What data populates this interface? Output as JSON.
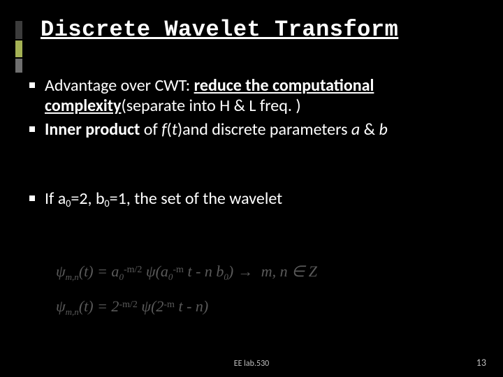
{
  "title": "Discrete Wavelet Transform",
  "bullets": {
    "b1": {
      "pre": "Advantage over CWT: ",
      "strong": "reduce the computational complexity",
      "post": "(separate into H & L freq. )"
    },
    "b2": {
      "strong": "Inner product",
      "mid": " of ",
      "fn": "f",
      "paren_t": "(",
      "t": "t",
      "paren_close": ")",
      "mid2": "and discrete parameters ",
      "a": "a",
      "amp": " & ",
      "b": "b"
    },
    "b3": {
      "pre": "If a",
      "sub0a": "0",
      "eq2": "=2, b",
      "sub0b": "0",
      "eq1": "=1, the set of the wavelet"
    }
  },
  "equations": {
    "line1": {
      "psi": "ψ",
      "sub": "m,n",
      "t": "(t)",
      "eq": " = a",
      "sub0": "0",
      "exp_pre": "",
      "exp": "-m/2",
      "psi2": " ψ",
      "arg_open": "(a",
      "sub0b": "0",
      "exp2": "-m",
      "rest": " t - n b",
      "sub0c": "0",
      "close": ")",
      "tail": "     m, n ∈ Z"
    },
    "line2": {
      "psi": "ψ",
      "sub": "m,n",
      "t": "(t)",
      "eq": " = 2",
      "exp": "-m/2",
      "psi2": " ψ",
      "arg": "(2",
      "exp2": "-m",
      "rest": " t - n)"
    }
  },
  "footer": {
    "center": "EE lab.530",
    "page": "13"
  }
}
